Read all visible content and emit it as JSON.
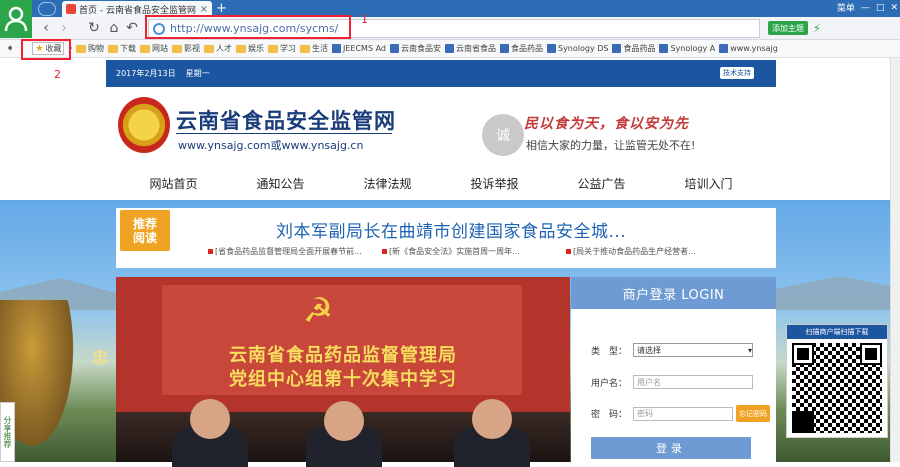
{
  "browser": {
    "tab_title": "首页 - 云南省食品安全监管网 -",
    "address": "http://www.ynsajg.com/sycms/",
    "window_controls": [
      "菜单",
      "—",
      "□",
      "✕"
    ],
    "nav_right": [
      "添加主题",
      "⚡"
    ],
    "bookmarks": [
      {
        "label": "收藏",
        "kind": "collect"
      },
      {
        "label": "购物",
        "kind": "folder"
      },
      {
        "label": "下载",
        "kind": "folder"
      },
      {
        "label": "网站",
        "kind": "folder"
      },
      {
        "label": "影视",
        "kind": "folder"
      },
      {
        "label": "人才",
        "kind": "folder"
      },
      {
        "label": "娱乐",
        "kind": "folder"
      },
      {
        "label": "学习",
        "kind": "folder"
      },
      {
        "label": "生活",
        "kind": "folder"
      },
      {
        "label": "JEECMS Ad",
        "kind": "fav"
      },
      {
        "label": "云南食品安",
        "kind": "fav"
      },
      {
        "label": "云南省食品",
        "kind": "fav"
      },
      {
        "label": "食品药品",
        "kind": "fav"
      },
      {
        "label": "Synology DS",
        "kind": "fav"
      },
      {
        "label": "食品药品",
        "kind": "fav"
      },
      {
        "label": "Synology A",
        "kind": "fav"
      },
      {
        "label": "www.ynsajg",
        "kind": "fav"
      }
    ],
    "annotation_1": "1",
    "annotation_2": "2"
  },
  "site": {
    "date": "2017年2月13日",
    "weekday": "星期一",
    "top_button": "技术支持",
    "title": "云南省食品安全监管网",
    "url_text": "www.ynsajg.com或www.ynsajg.cn",
    "cheng": "诚",
    "slogan": "民以食为天，食以安为先",
    "subslogan": "相信大家的力量，让监管无处不在!",
    "nav": [
      "网站首页",
      "通知公告",
      "法律法规",
      "投诉举报",
      "公益广告",
      "培训入门"
    ],
    "tuijian": "推荐\n阅读",
    "headline": "刘本军副局长在曲靖市创建国家食品安全城...",
    "sub_news": [
      "[省食品药品监督管理局全面开展春节前...",
      "[新《食品安全法》实施首周一周年...",
      "[局关于推动食品药品生产经营者..."
    ],
    "photo_line1": "云南省食品药品监督管理局",
    "photo_line2": "党组中心组第十次集中学习",
    "photo_emblem": "☭",
    "pavilion": "忠",
    "side_float": "分享推荐",
    "login": {
      "title": "商户登录 LOGIN",
      "type_label": "类　型：",
      "type_value": "请选择",
      "user_label": "用户名：",
      "user_placeholder": "用户名",
      "pass_label": "密　码：",
      "pass_placeholder": "密码",
      "forgot": "忘记密码",
      "submit": "登录"
    },
    "qr_title": "扫描商户端扫描下载"
  }
}
